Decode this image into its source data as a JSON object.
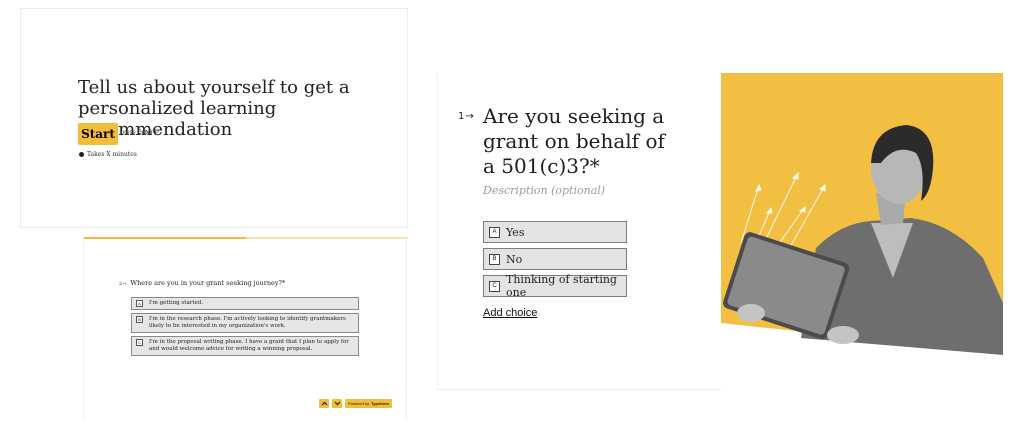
{
  "welcome": {
    "title": "Tell us about yourself to get a personalized learning recommendation",
    "start_label": "Start",
    "press_prefix": "press",
    "press_key": "Enter",
    "enter_glyph": "↵",
    "time_note": "Takes X minutes"
  },
  "journey": {
    "progress_fraction": 0.5,
    "number": "2",
    "arrow": "→",
    "question": "Where are you in your grant seeking journey?*",
    "options": [
      {
        "key": "A",
        "label": "I'm getting started."
      },
      {
        "key": "B",
        "label": "I'm in the research phase. I'm actively looking to identify grantmakers likely to be interested in my organization's work."
      },
      {
        "key": "C",
        "label": "I'm in the proposal writing phase. I have a grant that I plan to apply for and would welcome advice for writing a winning proposal."
      }
    ],
    "nav_up": "⌃",
    "nav_down": "⌄",
    "powered_prefix": "Powered by",
    "powered_brand": "Typeform"
  },
  "main_question": {
    "number": "1",
    "arrow": "→",
    "title": "Are you seeking a grant on behalf of a 501(c)3?*",
    "description_placeholder": "Description (optional)",
    "choices": [
      {
        "key": "A",
        "label": "Yes"
      },
      {
        "key": "B",
        "label": "No"
      },
      {
        "key": "C",
        "label": "Thinking of starting one"
      }
    ],
    "add_choice_label": "Add choice",
    "image_bg": "#f2bf43"
  },
  "colors": {
    "accent": "#f1bd3a",
    "choice_bg": "#e3e3e3"
  }
}
